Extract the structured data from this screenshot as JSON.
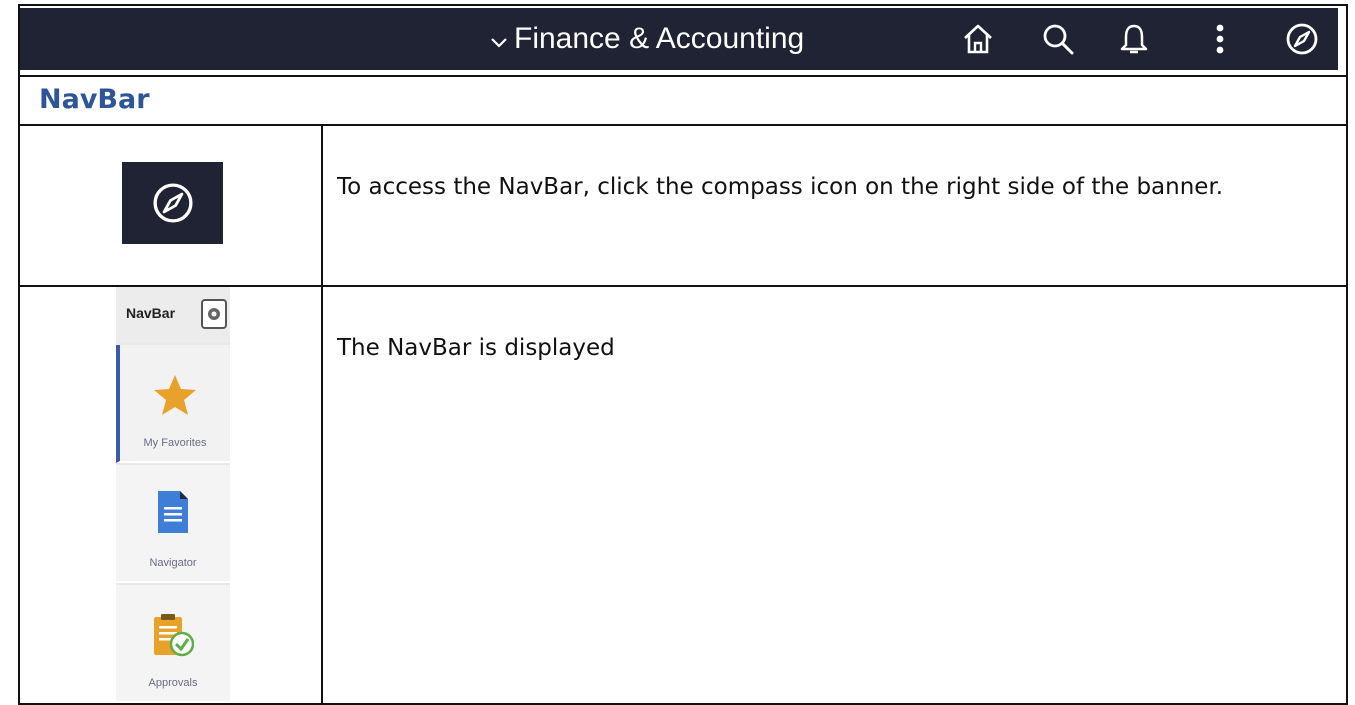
{
  "banner": {
    "title": "Finance & Accounting",
    "icons": [
      "home-icon",
      "search-icon",
      "bell-icon",
      "more-vertical-icon",
      "compass-icon"
    ],
    "bg_color": "#1f2333"
  },
  "section": {
    "title": "NavBar",
    "title_color": "#2e5597"
  },
  "steps": [
    {
      "text": "To access the NavBar, click the compass icon on the right side of the banner.",
      "image": "compass-icon"
    },
    {
      "text": "The NavBar is displayed",
      "image": "navbar-thumbnail"
    }
  ],
  "navbar_thumb": {
    "title": "NavBar",
    "items": [
      {
        "label": "My Favorites",
        "icon": "star-icon"
      },
      {
        "label": "Navigator",
        "icon": "document-icon"
      },
      {
        "label": "Approvals",
        "icon": "clipboard-check-icon"
      }
    ]
  }
}
